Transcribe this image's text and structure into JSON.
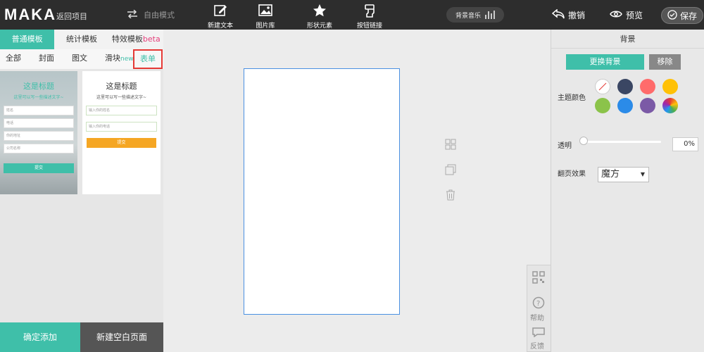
{
  "header": {
    "logo": "MAKA",
    "back_label": "返回项目",
    "mode_label": "自由模式",
    "tools": [
      {
        "label": "新建文本",
        "icon": "edit-icon"
      },
      {
        "label": "图片库",
        "icon": "image-icon"
      },
      {
        "label": "形状元素",
        "icon": "star-icon"
      },
      {
        "label": "按钮链接",
        "icon": "link-icon"
      }
    ],
    "music_label": "背景音乐",
    "undo_label": "撤销",
    "preview_label": "预览",
    "save_label": "保存"
  },
  "left_panel": {
    "tabs": [
      "普通模板",
      "统计模板",
      "特效模板"
    ],
    "beta_tag": "beta",
    "subtabs": [
      "全部",
      "封面",
      "图文",
      "滑块",
      "表单"
    ],
    "new_tag": "new",
    "template1": {
      "title": "这是标题",
      "subtitle": "这里可以写一些描述文字~",
      "fields": [
        "姓名",
        "电话",
        "你的地址",
        "公司名称"
      ],
      "button": "提交"
    },
    "template2": {
      "title": "这是标题",
      "subtitle": "这里可以写一些描述文字~",
      "fields": [
        "输入你的姓名",
        "输入你的电话"
      ],
      "button": "提交"
    },
    "confirm_button": "确定添加",
    "blank_button": "新建空白页面"
  },
  "right_panel": {
    "title": "背景",
    "change_bg": "更换背景",
    "remove": "移除",
    "theme_color_label": "主题颜色",
    "swatches": [
      "none",
      "#3a4663",
      "#ff6b6b",
      "#ffc107",
      "#8bc34a",
      "#2b8be8",
      "#7b5aa6",
      "gradient"
    ],
    "opacity_label": "透明",
    "opacity_value": "0%",
    "opacity_level": 0,
    "flip_label": "翻页效果",
    "flip_value": "魔方"
  },
  "float_box": {
    "help_label": "帮助",
    "feedback_label": "反馈"
  }
}
